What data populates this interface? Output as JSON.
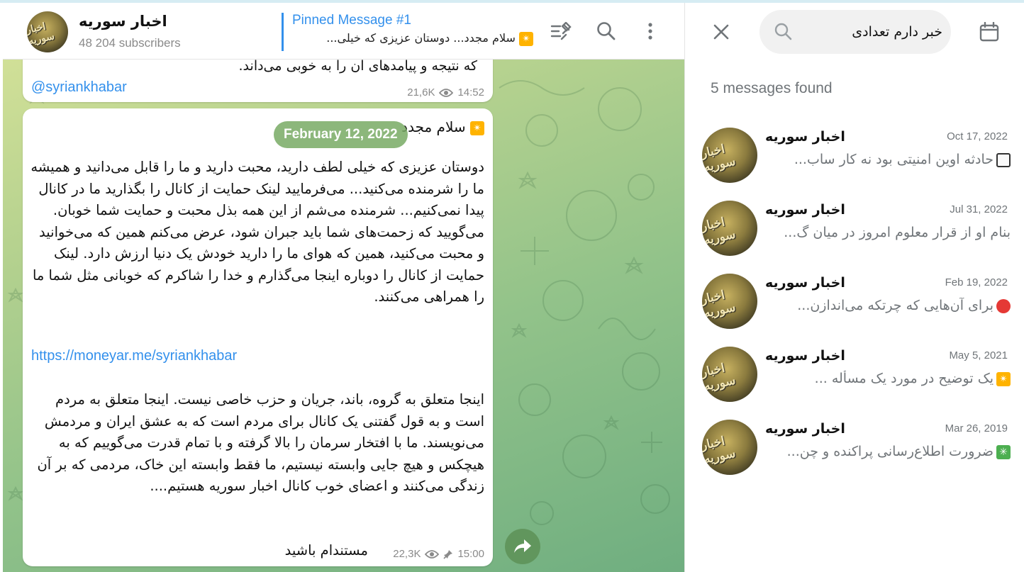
{
  "channel": {
    "name": "اخبار سوریه",
    "subscribers": "48 204 subscribers",
    "avatar_text": "اخبار سوریه"
  },
  "pinned": {
    "title": "Pinned Message #1",
    "text": "سلام مجدد... دوستان عزیزی که خیلی..."
  },
  "messages": {
    "top": {
      "text_cut": "که نتیجه و پیامدهای آن را به خوبی می‌داند.",
      "handle": "@syriankhabar",
      "views": "21,6K",
      "time": "14:52"
    },
    "main": {
      "date": "February 12, 2022",
      "greeting": "سلام مجدد",
      "paragraph1": "دوستان عزیزی که خیلی لطف دارید، محبت دارید و ما را قابل می‌دانید و همیشه ما را شرمنده می‌کنید... می‌فرمایید لینک حمایت از کانال را بگذارید ما در کانال پیدا نمی‌کنیم... شرمنده می‌شم از این همه بذل محبت و حمایت شما خوبان. می‌گویید که زحمت‌های شما باید جبران شود، عرض می‌کنم همین که می‌خوانید و محبت می‌کنید، همین که هوای ما را دارید خودش یک دنیا ارزش دارد. لینک حمایت از کانال را دوباره اینجا می‌گذارم و خدا را شاکرم که خوبانی مثل شما ما را همراهی می‌کنند.",
      "link": "https://moneyar.me/syriankhabar",
      "paragraph2": "اینجا متعلق به گروه، باند، جریان و حزب خاصی نیست. اینجا متعلق به مردم است و به قول گفتنی یک کانال برای مردم است که به عشق ایران و مردمش می‌نویسند. ما با افتخار سرمان را بالا گرفته و با تمام قدرت می‌گوییم که به هیچکس و هیچ جایی وابسته نیستیم، ما فقط وابسته این خاک، مردمی که بر آن زندگی می‌کنند و اعضای خوب کانال اخبار سوریه هستیم....",
      "closing": "مستندام باشید",
      "views": "22,3K",
      "time": "15:00"
    }
  },
  "search": {
    "query": "خبر دارم تعدادی",
    "found": "5 messages found",
    "results": [
      {
        "name": "اخبار سوریه",
        "date": "Oct 17, 2022",
        "snippet": "حادثه اوین امنیتی بود نه کار ساب...",
        "emoji": "white-square"
      },
      {
        "name": "اخبار سوریه",
        "date": "Jul 31, 2022",
        "snippet": "بنام او از قرار معلوم امروز در میان گ...",
        "emoji": ""
      },
      {
        "name": "اخبار سوریه",
        "date": "Feb 19, 2022",
        "snippet": "برای آن‌هایی که چرتکه می‌اندازن...",
        "emoji": "red-circle"
      },
      {
        "name": "اخبار سوریه",
        "date": "May 5, 2021",
        "snippet": "یک توضیح در مورد یک مسأله ...",
        "emoji": "orange-star"
      },
      {
        "name": "اخبار سوریه",
        "date": "Mar 26, 2019",
        "snippet": "ضرورت اطلاع‌رسانی پراکنده و چن...",
        "emoji": "green-star"
      }
    ]
  },
  "colors": {
    "accent": "#3390ec",
    "chat_bg_light": "#d9e49a",
    "chat_bg_dark": "#6fae80",
    "muted_text": "#707579"
  }
}
